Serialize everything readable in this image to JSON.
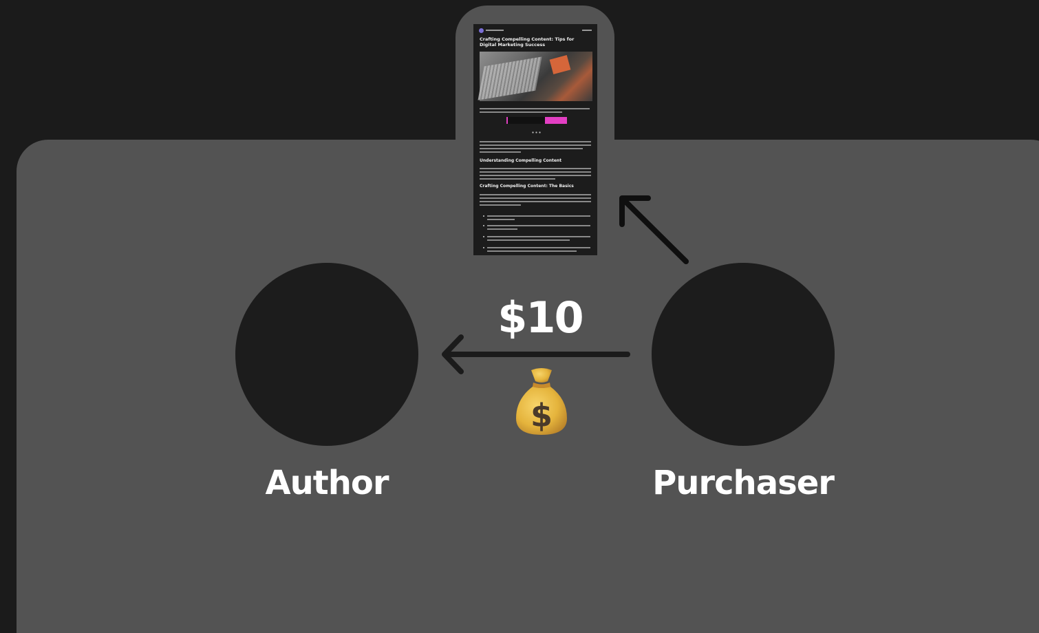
{
  "diagram": {
    "preview_title": "Crafting Compelling Content: Tips for Digital Marketing Success",
    "preview_heading_1": "Understanding Compelling Content",
    "preview_heading_2": "Crafting Compelling Content: The Basics",
    "author_label": "Author",
    "purchaser_label": "Purchaser",
    "price_label": "$10",
    "icons": {
      "money": "money-bag-icon",
      "pay_arrow": "arrow-left-icon",
      "access_arrow": "arrow-up-left-icon"
    },
    "colors": {
      "background": "#1b1b1b",
      "panel": "#535353",
      "node": "#1c1c1c",
      "accent": "#e33fc3"
    }
  }
}
